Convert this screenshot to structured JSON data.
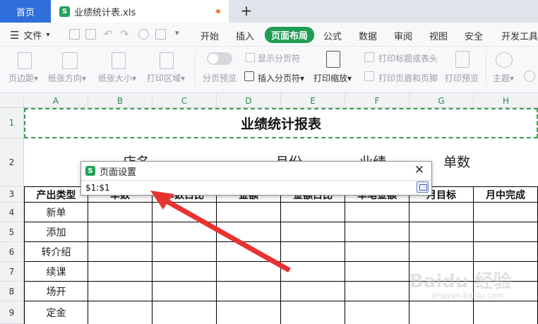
{
  "tabs": {
    "home": "首页",
    "file_badge": "S",
    "file_name": "业绩统计表.xls",
    "new_tab": "+"
  },
  "menu": {
    "file": "文件",
    "items": [
      "开始",
      "插入",
      "页面布局",
      "公式",
      "数据",
      "审阅",
      "视图",
      "安全",
      "开发工具"
    ],
    "active_index": 2
  },
  "ribbon": {
    "margins": "页边距",
    "orientation": "纸张方向",
    "size": "纸张大小",
    "print_area": "打印区域",
    "page_break_preview": "分页预览",
    "show_page_breaks": "显示分页符",
    "insert_page_break": "插入分页符",
    "print_scale": "打印缩放",
    "print_titles": "打印标题或表头",
    "print_header_footer": "打印页眉和页脚",
    "print_preview": "打印预览",
    "theme": "主题"
  },
  "columns": [
    "A",
    "B",
    "C",
    "D",
    "E",
    "F",
    "G",
    "H"
  ],
  "rows": [
    "1",
    "2",
    "3",
    "4",
    "5",
    "6",
    "7",
    "8",
    "9"
  ],
  "sheet": {
    "title": "业绩统计报表",
    "row2": [
      "店名",
      "月份",
      "业绩",
      "单数"
    ],
    "headers": [
      "产出类型",
      "单数",
      "单数占比",
      "金额",
      "金额占比",
      "单笔金额",
      "月目标",
      "月中完成"
    ],
    "row_labels": [
      "新单",
      "添加",
      "转介绍",
      "续课",
      "场开",
      "定金"
    ]
  },
  "dialog": {
    "logo": "S",
    "title": "页面设置",
    "value": "$1:$1",
    "close": "✕"
  },
  "watermark": {
    "main": "Baidu 经验",
    "sub": "jingyan.baidu.com"
  }
}
